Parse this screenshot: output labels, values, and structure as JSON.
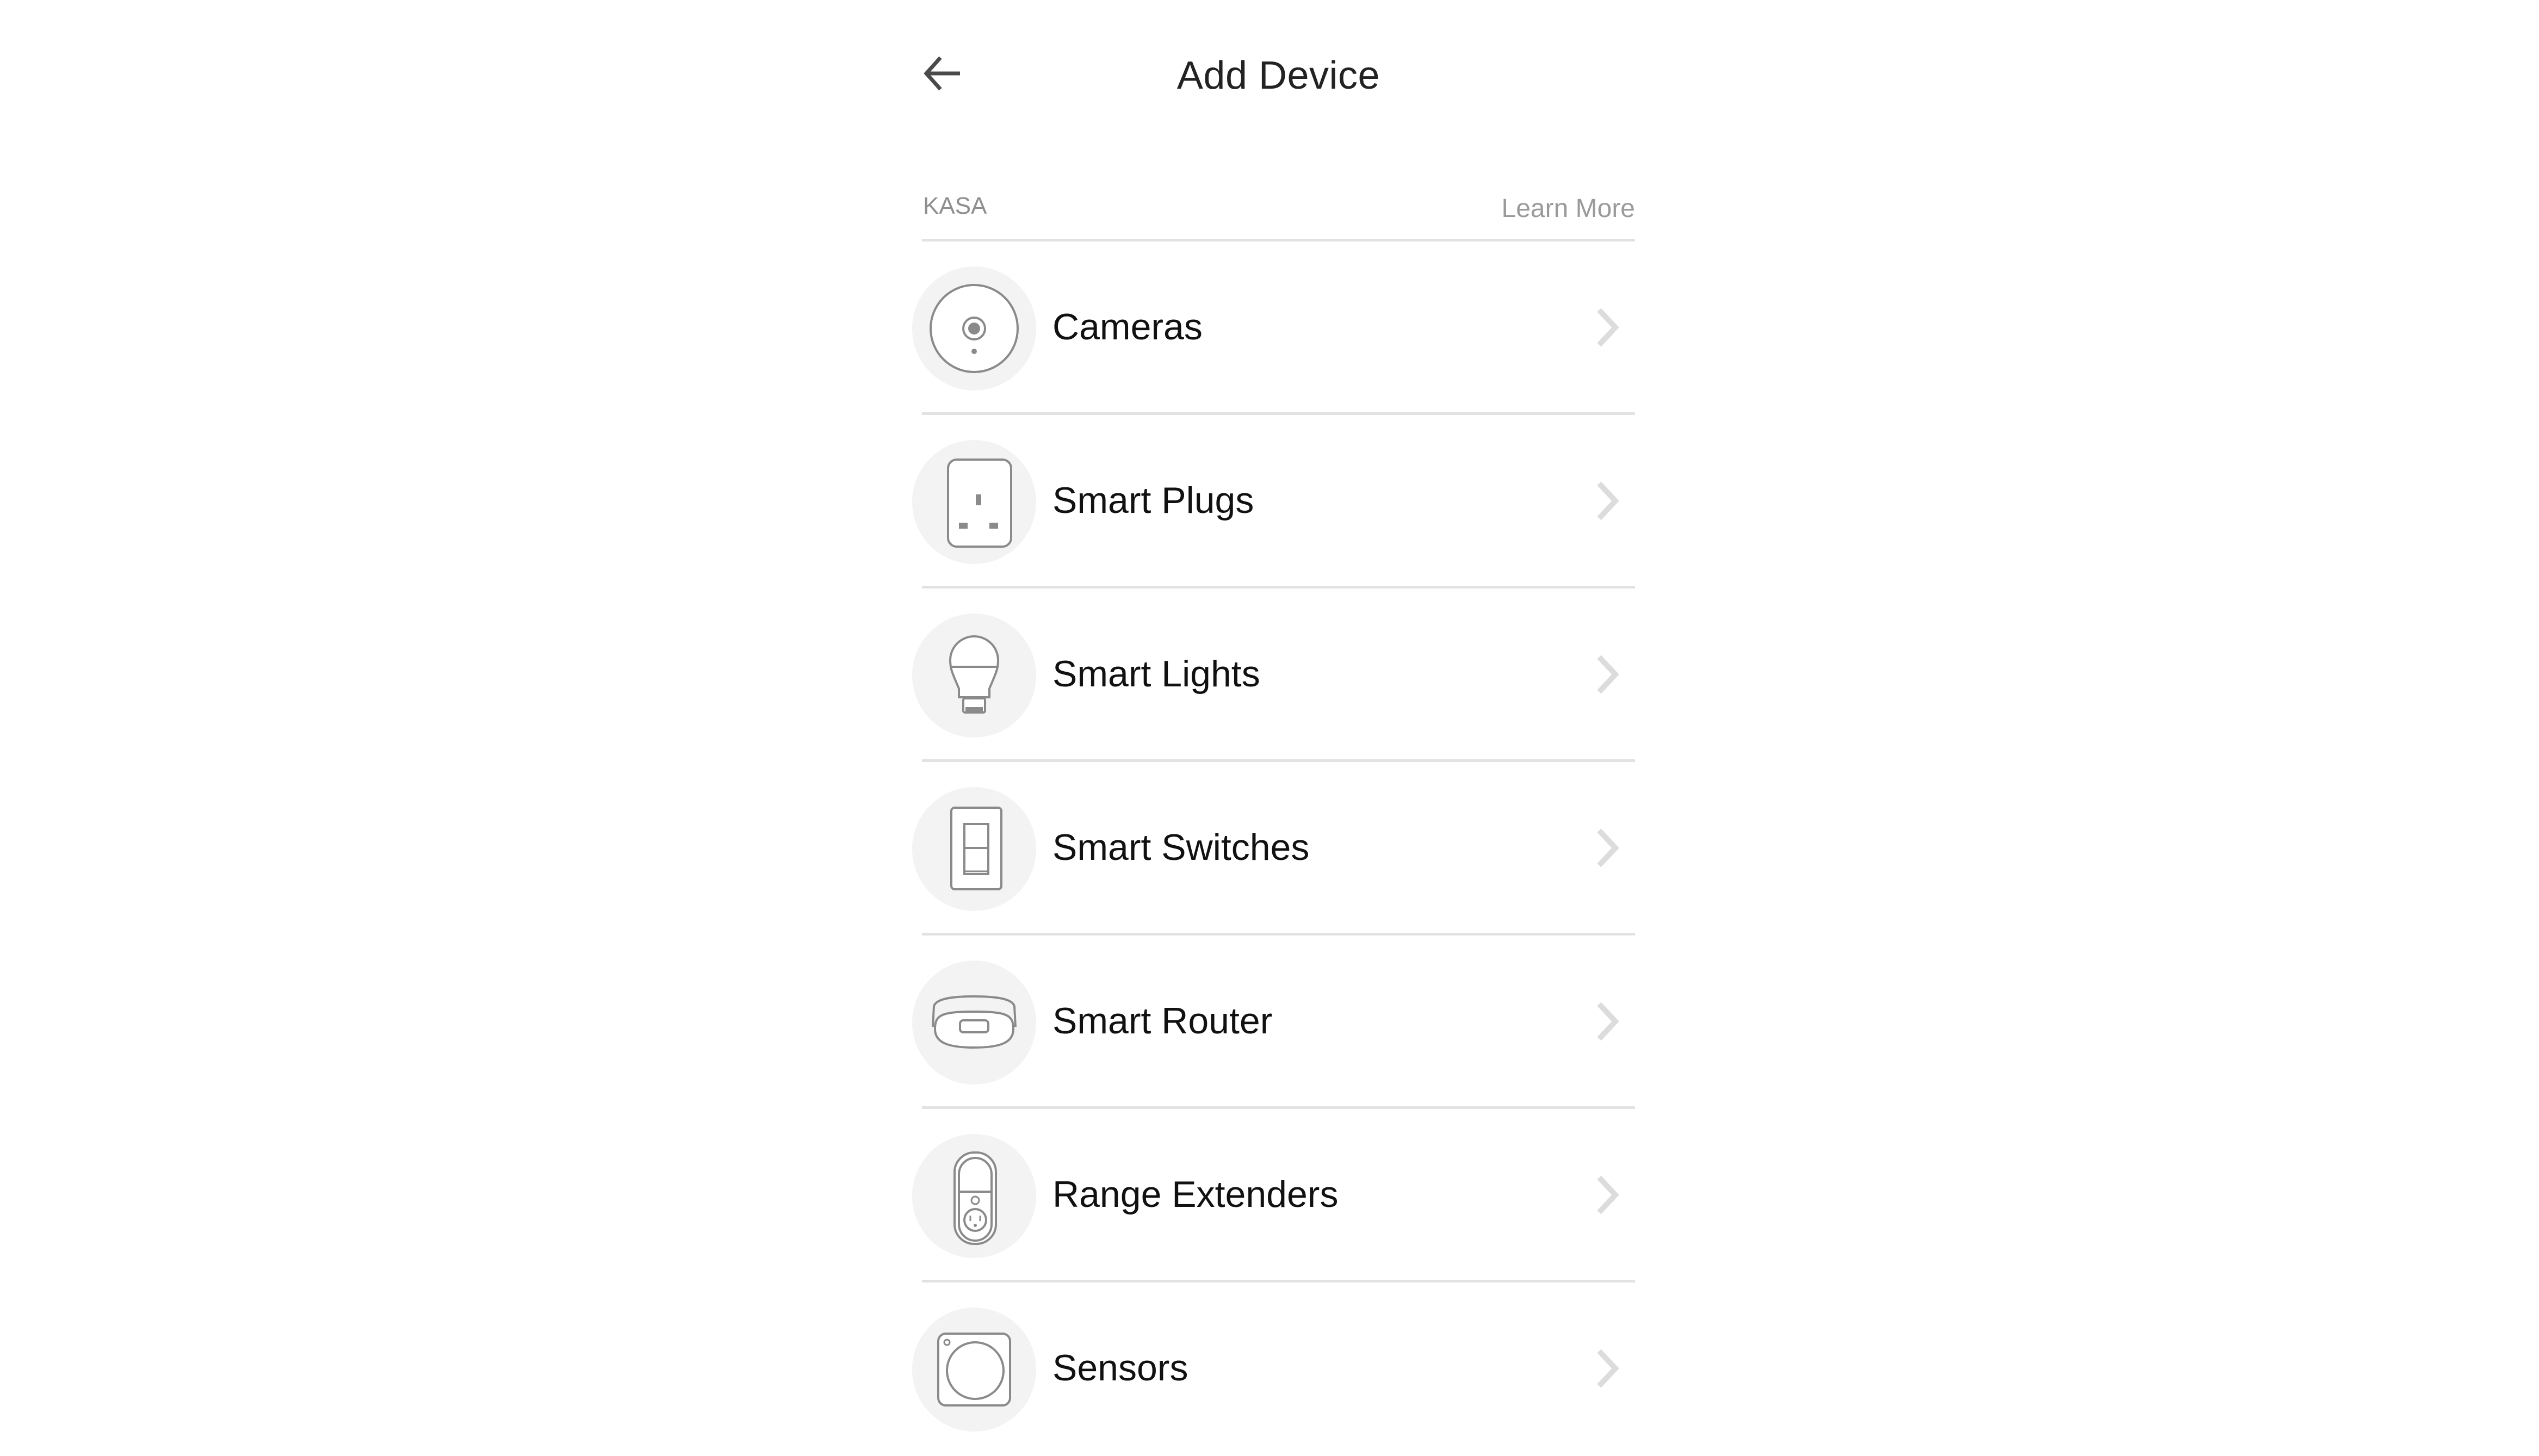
{
  "header": {
    "title": "Add Device",
    "back_icon": "arrow-left-icon"
  },
  "section": {
    "label": "KASA",
    "learn_more": "Learn More"
  },
  "devices": [
    {
      "label": "Cameras",
      "icon": "camera-icon"
    },
    {
      "label": "Smart Plugs",
      "icon": "smart-plug-icon"
    },
    {
      "label": "Smart Lights",
      "icon": "light-bulb-icon"
    },
    {
      "label": "Smart Switches",
      "icon": "light-switch-icon"
    },
    {
      "label": "Smart Router",
      "icon": "router-icon"
    },
    {
      "label": "Range Extenders",
      "icon": "range-extender-icon"
    },
    {
      "label": "Sensors",
      "icon": "sensor-icon"
    }
  ],
  "colors": {
    "icon_stroke": "#8a8a8a",
    "icon_bg": "#f3f3f3",
    "divider": "#e2e2e2",
    "chevron": "#dcdcdc",
    "muted_text": "#9a9a9a"
  }
}
